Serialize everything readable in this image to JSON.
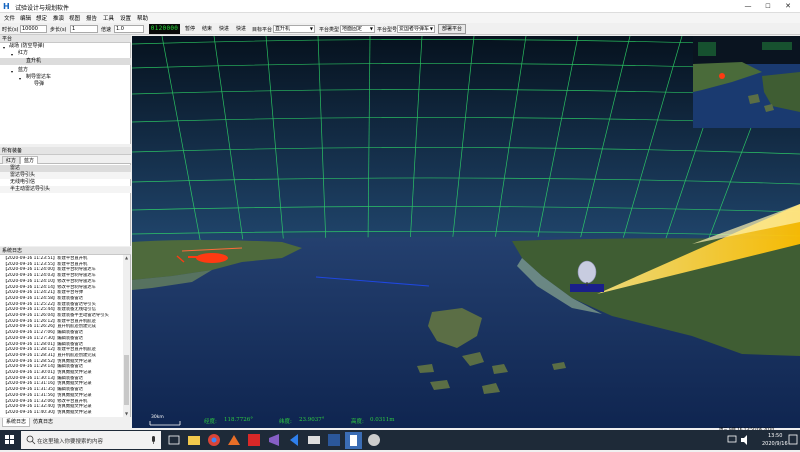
{
  "window": {
    "title": "试验设计与规划软件",
    "icon_glyph": "H",
    "minimize": "—",
    "maximize": "☐",
    "close": "✕"
  },
  "menu": [
    "文件",
    "编辑",
    "想定",
    "推演",
    "视图",
    "报告",
    "工具",
    "设置",
    "帮助"
  ],
  "toolbar": {
    "duration_label": "时长(s)",
    "duration_value": "10000",
    "step_label": "步长(s)",
    "step_value": "1",
    "speed_label": "倍速",
    "speed_value": "1.0",
    "clock": "0120000",
    "pause": "暂停",
    "stop": "结束",
    "fast": "快进",
    "faster": "快进",
    "target_platform_label": "目标平台",
    "target_platform_value": "直升机",
    "platform_type_label": "平台类型",
    "platform_type_value": "地面固定",
    "platform_model_label": "平台型号",
    "platform_model_value": "爱国者导弹车",
    "deploy": "部署平台"
  },
  "platform_panel": {
    "header": "平台",
    "tree": {
      "root": "战场 (防空导弹)",
      "red": "红方",
      "red_child": "直升机",
      "blue": "蓝方",
      "blue_child": "制导雷达车",
      "blue_grandchild": "导弹"
    }
  },
  "equipment_panel": {
    "header": "所有装备",
    "tabs": [
      "红方",
      "蓝方"
    ],
    "active_tab": 1,
    "items": [
      "雷达",
      "雷达导引头",
      "无线电引信",
      "半主动雷达导引头"
    ]
  },
  "system_log": {
    "header": "系统日志",
    "lines": [
      "【2020-09-16 11:23:51】新建平台直升机",
      "【2020-09-16 11:23:55】新建平台直升机",
      "【2020-09-16 11:24:00】新建平台制导雷达车",
      "【2020-09-16 11:24:03】新建平台制导雷达车",
      "【2020-09-16 11:24:10】修改平台制导雷达车",
      "【2020-09-16 11:24:14】修改平台制导雷达车",
      "【2020-09-16 11:24:21】新建平台导弹",
      "【2020-09-16 11:24:58】新建装备雷达",
      "【2020-09-16 11:25:22】新建装备雷达导引头",
      "【2020-09-16 11:25:44】新建装备无线电引信",
      "【2020-09-16 11:26:04】新建装备半主动雷达导引头",
      "【2020-09-16 11:26:12】新建平台直升机航迹",
      "【2020-09-16 11:26:26】直升机航迹创建完成",
      "【2020-09-16 11:27:06】编辑装备雷达",
      "【2020-09-16 11:27:30】编辑装备雷达",
      "【2020-09-16 11:28:01】编辑装备雷达",
      "【2020-09-16 11:28:12】新建平台直升机航迹",
      "【2020-09-16 11:28:31】直升机航迹创建完成",
      "【2020-09-16 11:28:52】仿真数据文件记录",
      "【2020-09-16 11:29:14】编辑装备雷达",
      "【2020-09-16 11:30:01】仿真数据文件记录",
      "【2020-09-16 11:30:13】编辑装备雷达",
      "【2020-09-16 11:31:16】仿真数据文件记录",
      "【2020-09-16 11:31:35】编辑装备雷达",
      "【2020-09-16 11:31:56】仿真数据文件记录",
      "【2020-09-16 11:32:06】修改平台直升机",
      "【2020-09-16 11:32:40】仿真数据文件记录",
      "【2020-09-16 11:40:30】仿真数据文件记录"
    ],
    "tabs": [
      "系统日志",
      "仿真日志"
    ],
    "active_tab": 0
  },
  "view": {
    "scale": "30km",
    "lon_label": "经度:",
    "lon_value": "118.7726°",
    "lat_label": "纬度:",
    "lat_value": "23.9037°",
    "alt_label": "高度:",
    "alt_value": "0.0311m",
    "colors": {
      "sky_top": "#06121e",
      "sky_bottom": "#4f7fb0",
      "sea": "#16305c",
      "grid": "#2fdc6a",
      "beam": "#ffd21a",
      "helicopter": "#ff3a12",
      "missile_line": "#1f47e0",
      "readout": "#2ecc40"
    }
  },
  "taskbar": {
    "search_placeholder": "在这里输入你要搜索的内容",
    "apps": [
      "task-view-icon",
      "file-explorer-icon",
      "chrome-icon",
      "matlab-icon",
      "acrobat-icon",
      "visual-studio-icon",
      "vscode-icon",
      "mail-icon",
      "word-icon",
      "app-icon",
      "browser-icon"
    ],
    "status": "周三 9月 16 13:50:06 2020",
    "time": "13:50",
    "date": "2020/9/16"
  }
}
